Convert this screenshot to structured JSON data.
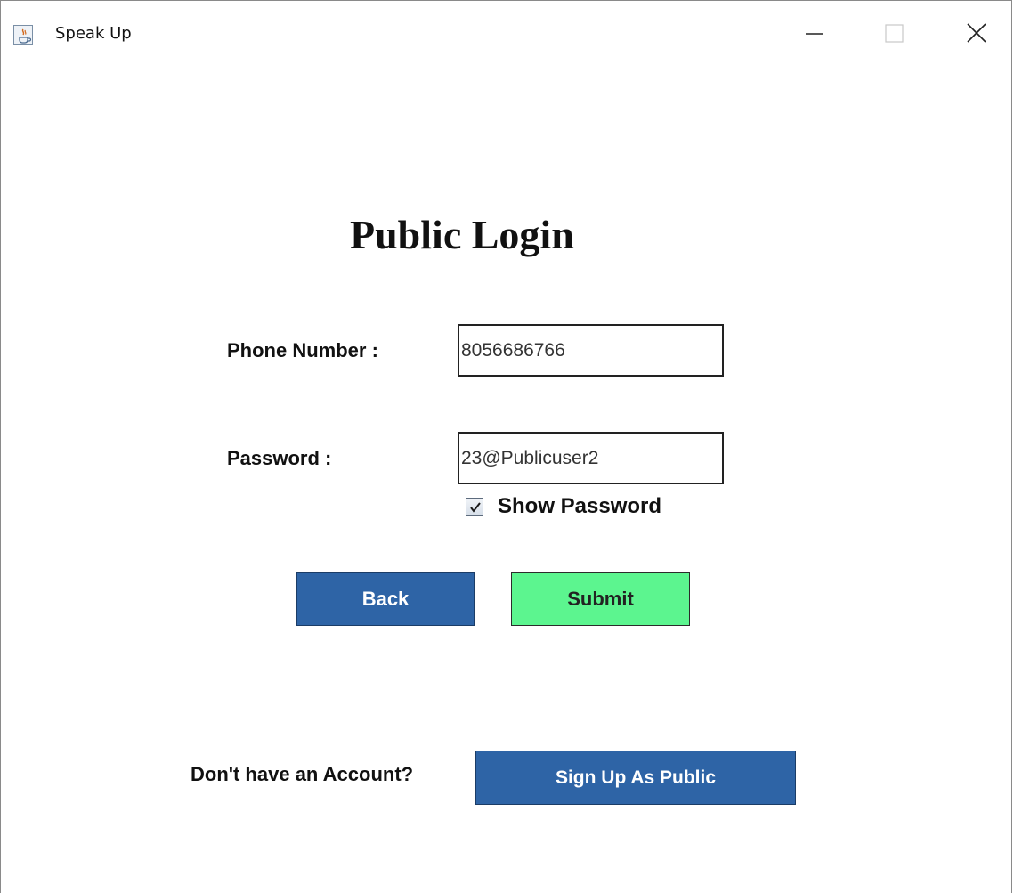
{
  "window": {
    "title": "Speak Up",
    "icon": "java-cup-icon",
    "controls": [
      "minimize-icon",
      "maximize-icon",
      "close-icon"
    ]
  },
  "form": {
    "heading": "Public Login",
    "phone_label": "Phone Number  :",
    "phone_value": "8056686766",
    "password_label": "Password  :",
    "password_value": "23@Publicuser2",
    "show_password_label": "Show Password",
    "show_password_checked": true,
    "back_label": "Back",
    "submit_label": "Submit",
    "signup_prompt": "Don't have an Account?",
    "signup_label": "Sign Up As Public"
  },
  "colors": {
    "primary_button": "#2e64a6",
    "submit_button": "#5cf58f",
    "background": "#ffffff"
  }
}
